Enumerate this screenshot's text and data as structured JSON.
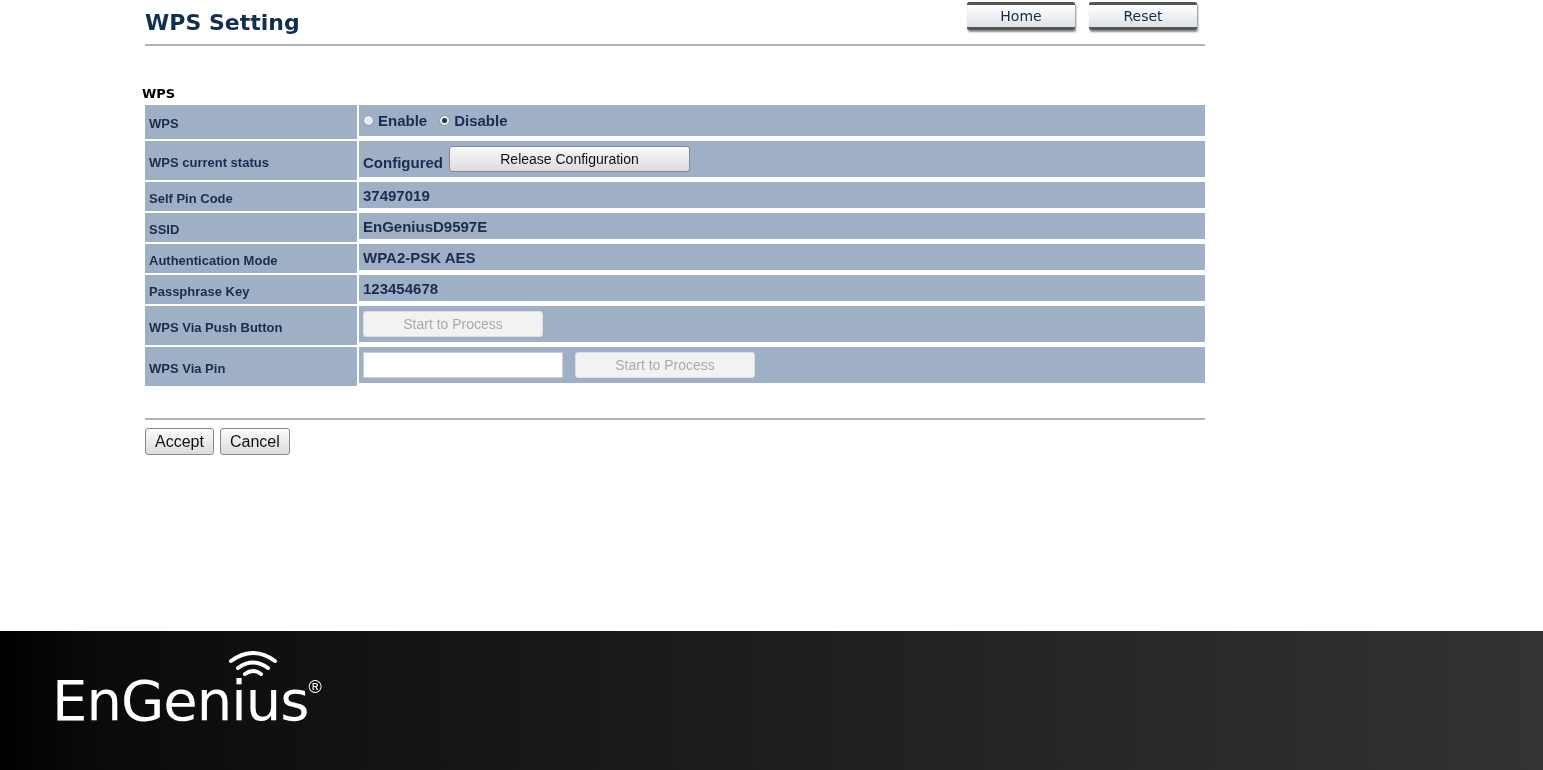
{
  "header": {
    "title": "WPS Setting",
    "buttons": [
      "Home",
      "Reset"
    ]
  },
  "section": {
    "title": "WPS"
  },
  "rows": [
    {
      "kind": "radio",
      "label": "WPS",
      "options": [
        {
          "label": "Enable",
          "selected": false
        },
        {
          "label": "Disable",
          "selected": true
        }
      ]
    },
    {
      "kind": "status",
      "label": "WPS current status",
      "value": "Configured",
      "button": {
        "label": "Release Configuration",
        "disabled": false
      }
    },
    {
      "kind": "text",
      "label": "Self Pin Code",
      "value": "37497019"
    },
    {
      "kind": "text",
      "label": "SSID",
      "value": "EnGeniusD9597E"
    },
    {
      "kind": "text",
      "label": "Authentication Mode",
      "value": "WPA2-PSK AES"
    },
    {
      "kind": "text",
      "label": "Passphrase Key",
      "value": "123454678"
    },
    {
      "kind": "button",
      "label": "WPS Via Push Button",
      "button": {
        "label": "Start to Process",
        "disabled": true
      }
    },
    {
      "kind": "pin",
      "label": "WPS Via Pin",
      "button": {
        "label": "Start to Process",
        "disabled": true
      }
    }
  ],
  "actions": [
    "Accept",
    "Cancel"
  ],
  "footer": {
    "brand": "EnGenius",
    "mark": "®"
  }
}
